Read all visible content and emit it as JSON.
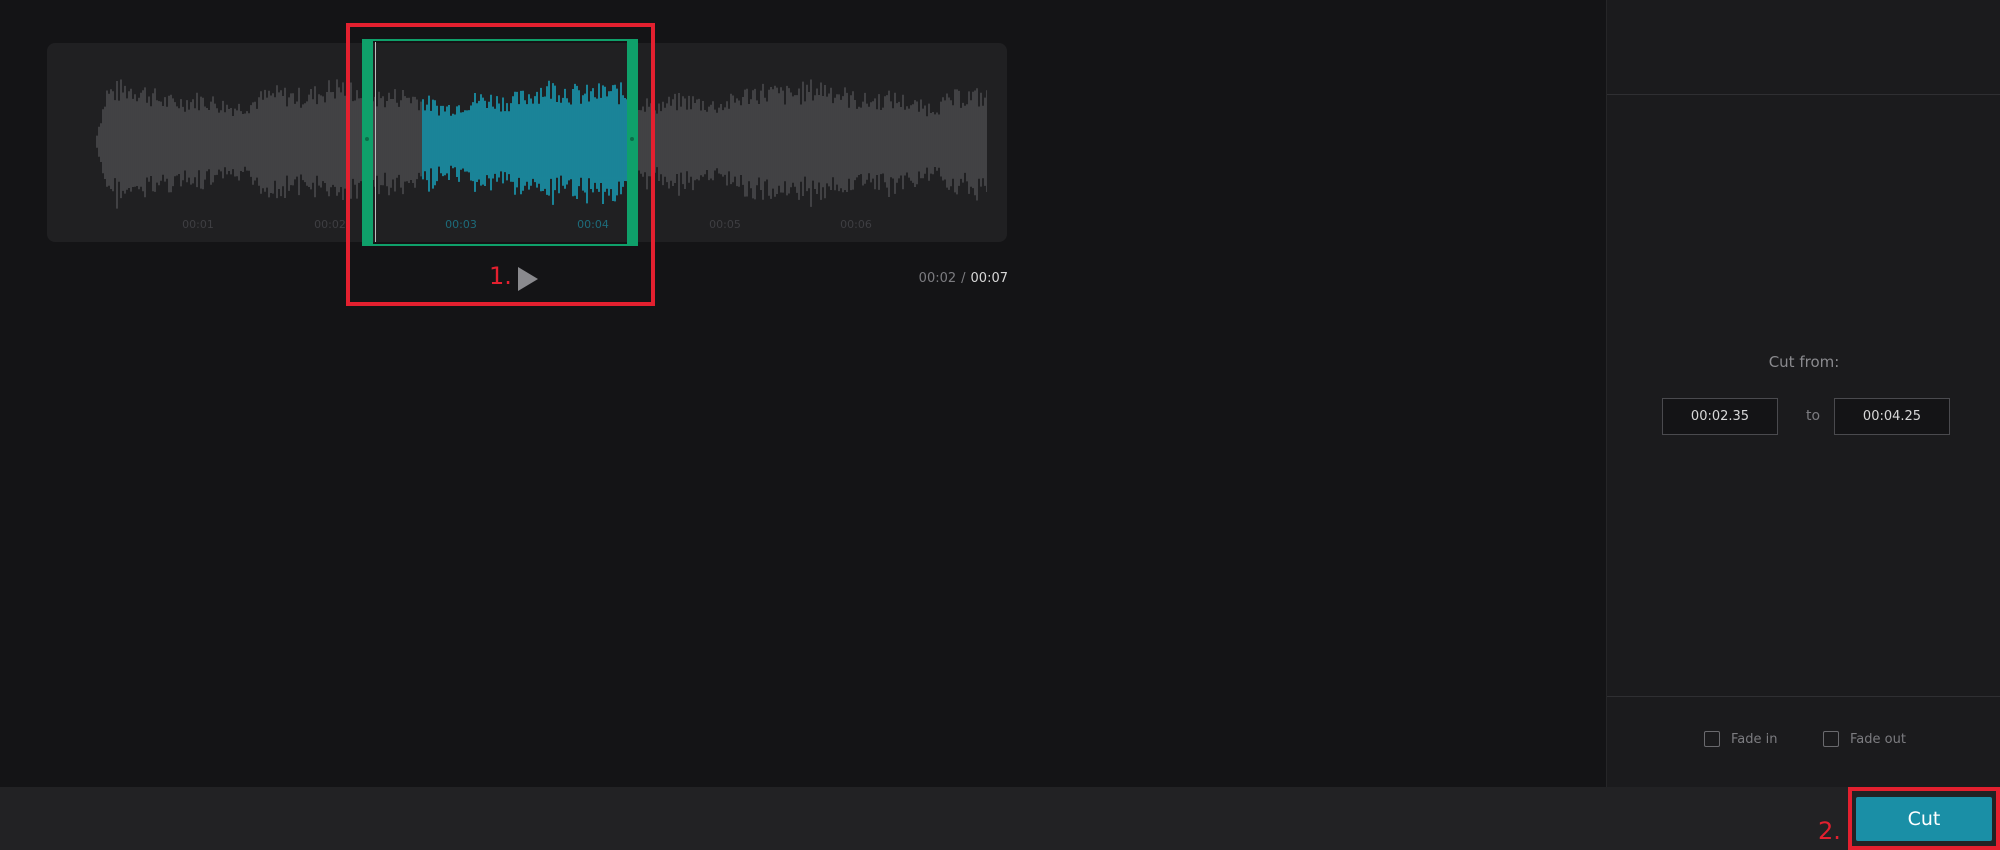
{
  "editor": {
    "timeline_ticks": [
      "00:01",
      "00:02",
      "00:03",
      "00:04",
      "00:05",
      "00:06"
    ],
    "current_time": "00:02",
    "time_separator": "/",
    "total_time": "00:07",
    "play_icon": "play-icon",
    "selection": {
      "start": "00:02.35",
      "end": "00:04.25"
    }
  },
  "annotations": {
    "step1": "1.",
    "step2": "2."
  },
  "panel": {
    "cut_from_label": "Cut from:",
    "from_value": "00:02.35",
    "to_label": "to",
    "to_value": "00:04.25",
    "fade_in_label": "Fade in",
    "fade_out_label": "Fade out",
    "fade_in_checked": false,
    "fade_out_checked": false
  },
  "actions": {
    "cut_label": "Cut"
  },
  "colors": {
    "waveform": "#4a4a4d",
    "selected_waveform": "#1a8fa6",
    "selection_handle": "#0fa06a",
    "cut_button": "#1a8fa6",
    "annotation": "#e3202f"
  }
}
